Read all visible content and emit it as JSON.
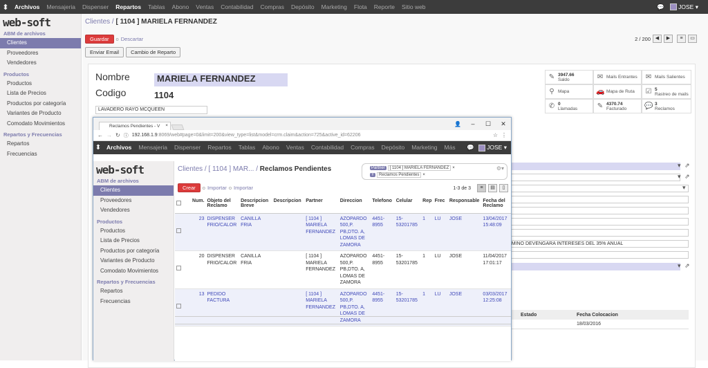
{
  "topbar": {
    "menu": [
      "Archivos",
      "Mensajeria",
      "Dispenser",
      "Repartos",
      "Tablas",
      "Abono",
      "Ventas",
      "Contabilidad",
      "Compras",
      "Depósito",
      "Marketing",
      "Flota",
      "Reporte",
      "Sitio web"
    ],
    "active": [
      "Archivos",
      "Repartos"
    ],
    "user": "JOSE"
  },
  "brand": "web-soft",
  "sidebar": {
    "sections": [
      {
        "title": "ABM de archivos",
        "items": [
          "Clientes",
          "Proveedores",
          "Vendedores"
        ]
      },
      {
        "title": "Productos",
        "items": [
          "Productos",
          "Lista de Precios",
          "Productos por categoría",
          "Variantes de Producto",
          "Comodato Movimientos"
        ]
      },
      {
        "title": "Repartos y Frecuencias",
        "items": [
          "Repartos",
          "Frecuencias"
        ]
      }
    ]
  },
  "breadcrumb": {
    "root": "Clientes",
    "sep": "/",
    "current": "[ 1104 ] MARIELA FERNANDEZ"
  },
  "buttons": {
    "save": "Guardar",
    "or": "o",
    "discard": "Descartar",
    "email": "Enviar Email",
    "change": "Cambio de Reparto"
  },
  "pager": {
    "text": "2 / 200"
  },
  "form": {
    "name_label": "Nombre",
    "name_value": "MARIELA FERNANDEZ",
    "code_label": "Codigo",
    "code_value": "1104",
    "tag": "LAVADERO RAYO MCQUEEN",
    "stats": [
      {
        "icon": "pencil-icon",
        "value": "3947.66",
        "label": "Saldo"
      },
      {
        "icon": "envelope-icon",
        "value": "",
        "label": "Mails Entrantes"
      },
      {
        "icon": "envelope-icon",
        "value": "",
        "label": "Mails Salientes"
      },
      {
        "icon": "map-marker-icon",
        "value": "",
        "label": "Mapa"
      },
      {
        "icon": "car-icon",
        "value": "",
        "label": "Mapa de Ruta"
      },
      {
        "icon": "checkbox-icon",
        "value": "5",
        "label": "Rastreo de mails"
      },
      {
        "icon": "phone-icon",
        "value": "0",
        "label": "Llamadas"
      },
      {
        "icon": "pencil-icon",
        "value": "4370.74",
        "label": "Facturado"
      },
      {
        "icon": "comments-icon",
        "value": "3",
        "label": "Reclamos"
      }
    ],
    "note": "ERMINO DEVENGARA INTERESES DEL 35% ANUAL",
    "table_headers": [
      "Estado",
      "Fecha Colocacion"
    ],
    "table_row": [
      "",
      "18/03/2016"
    ]
  },
  "browser": {
    "tab_title": "Reclamos Pendientes - V",
    "url_host": "192.168.1.9",
    "url_rest": ":8069/web#page=0&limit=200&view_type=list&model=crm.claim&action=725&active_id=62206",
    "menu": [
      "Archivos",
      "Mensajeria",
      "Dispenser",
      "Repartos",
      "Tablas",
      "Abono",
      "Ventas",
      "Contabilidad",
      "Compras",
      "Depósito",
      "Marketing",
      "Más"
    ],
    "user": "JOSE",
    "breadcrumb": {
      "a": "Clientes",
      "b": "[ 1104 ] MAR...",
      "c": "Reclamos Pendientes"
    },
    "facets": [
      {
        "label": "Partner",
        "value": "[ 1104 ] MARIELA FERNANDEZ"
      },
      {
        "label": "Y",
        "value": "Reclamos Pendientes"
      }
    ],
    "create": "Crear",
    "import": "Importar",
    "pager": "1-3 de 3",
    "columns": [
      "Num.",
      "Objeto del Reclamo",
      "Descripcion Breve",
      "Descripcion",
      "Partner",
      "Direccion",
      "Telefono",
      "Celular",
      "Rep",
      "Frec",
      "Responsable",
      "Fecha del Reclamo"
    ],
    "rows": [
      [
        "23",
        "DISPENSER FRIO/CALOR",
        "CANILLA FRIA",
        "",
        "[ 1104 ] MARIELA FERNANDEZ",
        "AZOPARDO 500,P. PB,DTO. A, LOMAS DE ZAMORA",
        "4451-8955",
        "15-53201785",
        "1",
        "LU",
        "JOSE",
        "13/04/2017 15:48:09"
      ],
      [
        "20",
        "DISPENSER FRIO/CALOR",
        "CANILLA FRIA",
        "",
        "[ 1104 ] MARIELA FERNANDEZ",
        "AZOPARDO 500,P. PB,DTO. A, LOMAS DE ZAMORA",
        "4451-8955",
        "15-53201785",
        "1",
        "LU",
        "JOSE",
        "11/04/2017 17:01:17"
      ],
      [
        "13",
        "PEDIDO FACTURA",
        "",
        "",
        "[ 1104 ] MARIELA FERNANDEZ",
        "AZOPARDO 500,P. PB,DTO. A, LOMAS DE ZAMORA",
        "4451-8955",
        "15-53201785",
        "1",
        "LU",
        "JOSE",
        "03/03/2017 12:25:08"
      ]
    ]
  }
}
